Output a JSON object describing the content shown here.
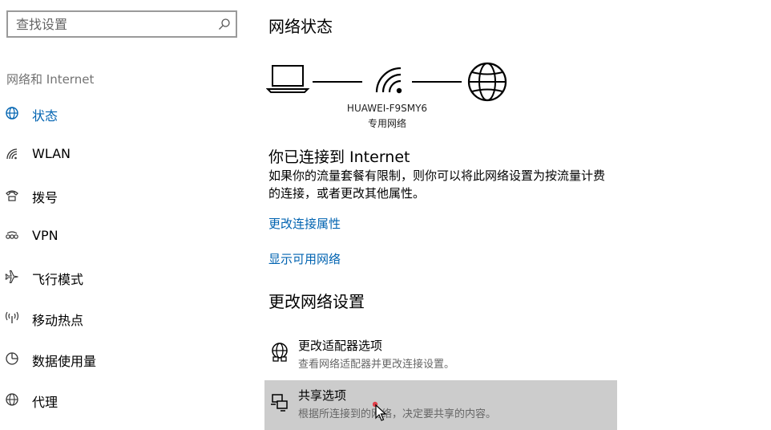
{
  "search": {
    "placeholder": "查找设置"
  },
  "sidebar": {
    "section_label": "网络和 Internet",
    "items": [
      {
        "label": "状态",
        "icon": "status-icon",
        "active": true
      },
      {
        "label": "WLAN",
        "icon": "wifi-icon"
      },
      {
        "label": "拨号",
        "icon": "dialup-icon"
      },
      {
        "label": "VPN",
        "icon": "vpn-icon"
      },
      {
        "label": "飞行模式",
        "icon": "airplane-icon"
      },
      {
        "label": "移动热点",
        "icon": "hotspot-icon"
      },
      {
        "label": "数据使用量",
        "icon": "data-usage-icon"
      },
      {
        "label": "代理",
        "icon": "proxy-globe-icon"
      }
    ]
  },
  "main": {
    "title": "网络状态",
    "network": {
      "name": "HUAWEI-F9SMY6",
      "type": "专用网络"
    },
    "connection": {
      "title": "你已连接到 Internet",
      "description": "如果你的流量套餐有限制，则你可以将此网络设置为按流量计费的连接，或者更改其他属性。"
    },
    "links": {
      "change_properties": "更改连接属性",
      "show_networks": "显示可用网络"
    },
    "section_title": "更改网络设置",
    "settings": [
      {
        "title": "更改适配器选项",
        "description": "查看网络适配器并更改连接设置。",
        "icon": "adapter-globe-icon"
      },
      {
        "title": "共享选项",
        "description": "根据所连接到的网络，决定要共享的内容。",
        "icon": "sharing-icon"
      }
    ]
  },
  "colors": {
    "accent": "#0063b1",
    "hover_bg": "#cccccc"
  }
}
